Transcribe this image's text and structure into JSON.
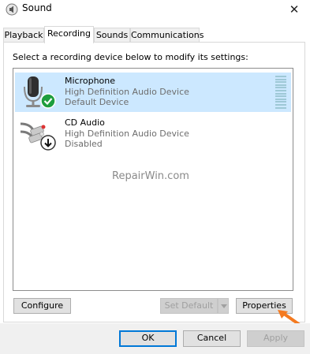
{
  "window": {
    "title": "Sound",
    "close_glyph": "✕"
  },
  "tabs": [
    {
      "label": "Playback",
      "active": false
    },
    {
      "label": "Recording",
      "active": true
    },
    {
      "label": "Sounds",
      "active": false
    },
    {
      "label": "Communications",
      "active": false
    }
  ],
  "instruction": "Select a recording device below to modify its settings:",
  "devices": [
    {
      "name": "Microphone",
      "driver": "High Definition Audio Device",
      "status": "Default Device",
      "icon": "microphone-icon",
      "badge": "green-check-icon",
      "selected": true,
      "level_meter_bars": 12
    },
    {
      "name": "CD Audio",
      "driver": "High Definition Audio Device",
      "status": "Disabled",
      "icon": "cd-audio-cable-icon",
      "badge": "down-arrow-disabled-icon",
      "selected": false
    }
  ],
  "watermark": "RepairWin.com",
  "buttons": {
    "configure": "Configure",
    "set_default": "Set Default",
    "properties": "Properties",
    "ok": "OK",
    "cancel": "Cancel",
    "apply": "Apply"
  },
  "colors": {
    "selection": "#cce8ff",
    "default_button_border": "#0078d7",
    "annotation_arrow": "#f47a20",
    "check_badge": "#1e9e3e"
  }
}
